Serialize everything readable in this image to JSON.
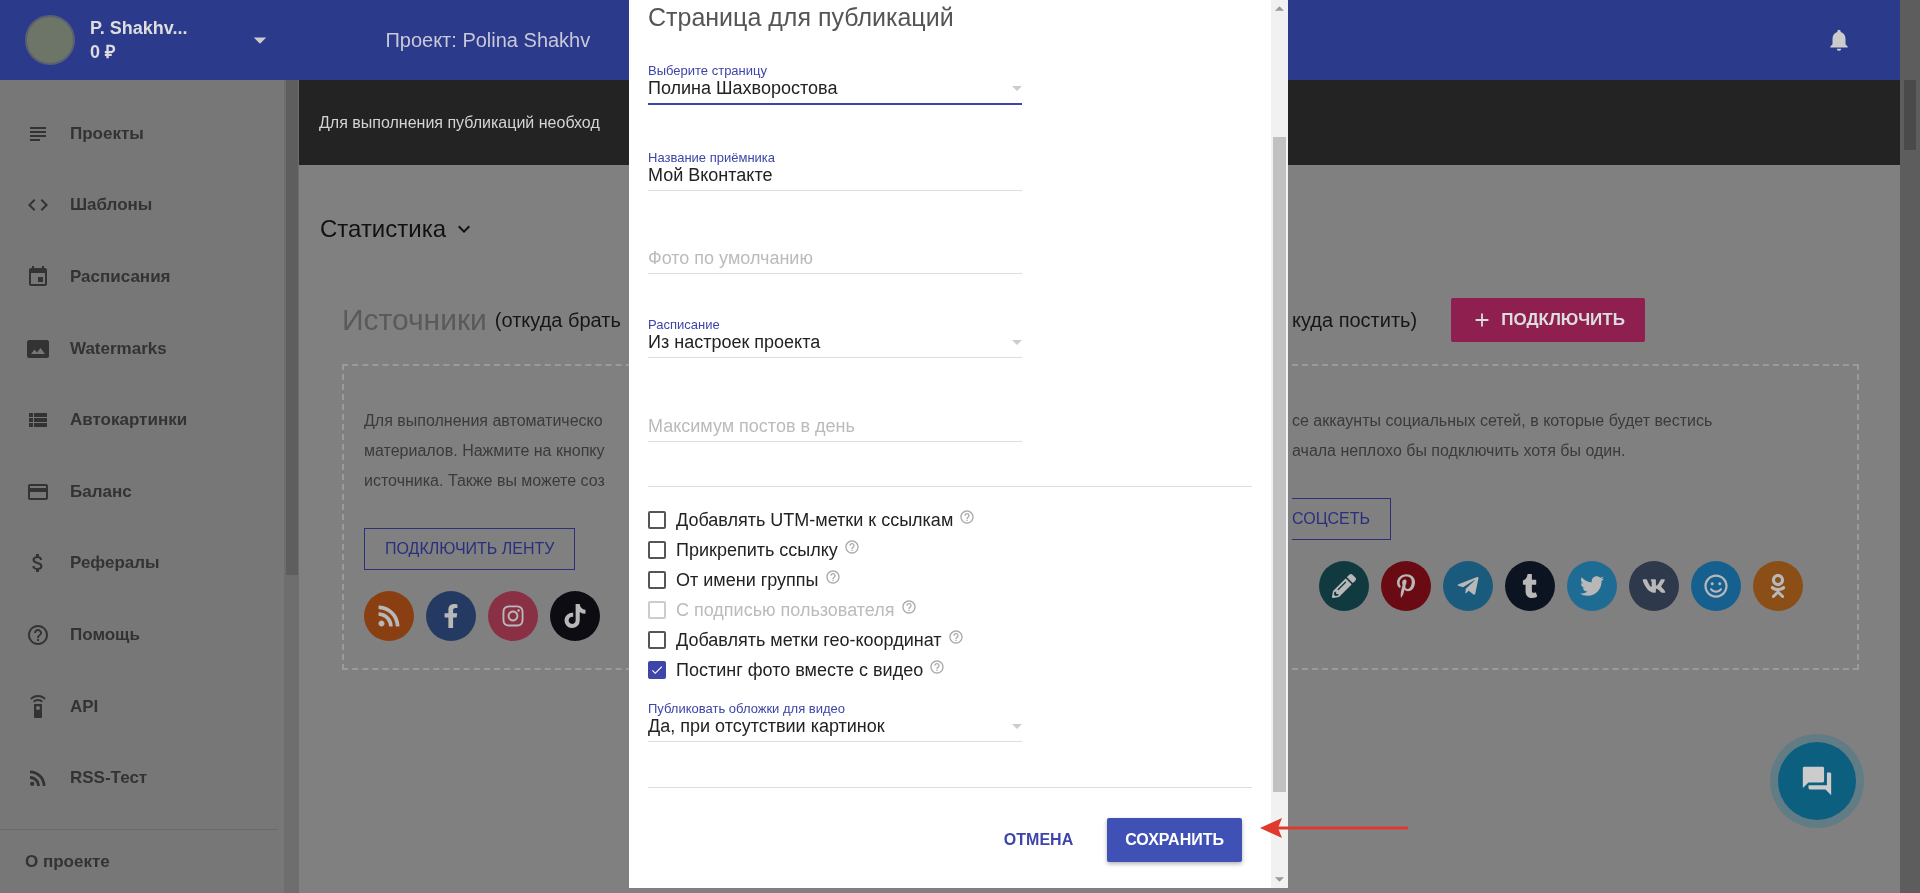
{
  "header": {
    "user_name": "P. Shakhv...",
    "balance": "0 ₽",
    "project_title": "Проект: Polina Shakhv"
  },
  "sidebar": {
    "items": [
      {
        "label": "Проекты"
      },
      {
        "label": "Шаблоны"
      },
      {
        "label": "Расписания"
      },
      {
        "label": "Watermarks"
      },
      {
        "label": "Автокартинки"
      },
      {
        "label": "Баланс"
      },
      {
        "label": "Рефералы"
      },
      {
        "label": "Помощь"
      },
      {
        "label": "API"
      },
      {
        "label": "RSS-Тест"
      }
    ],
    "footer": "О проекте"
  },
  "banner": "Для выполнения публикаций необход",
  "stats_label": "Статистика",
  "sources": {
    "title": "Источники",
    "subtitle": "(откуда брать",
    "text_lines": [
      "Для выполнения автоматическо",
      "материалов. Нажмите на кнопку",
      "источника. Также вы можете соз"
    ],
    "button": "ПОДКЛЮЧИТЬ ЛЕНТУ"
  },
  "targets": {
    "subtitle": "куда постить)",
    "connect_button": "ПОДКЛЮЧИТЬ",
    "text_lines": [
      "се аккаунты социальных сетей, в которые будет вестись",
      "ачала неплохо бы подключить хотя бы один."
    ],
    "button": "СОЦСЕТЬ"
  },
  "modal": {
    "title": "Страница для публикаций",
    "fields": [
      {
        "kind": "select",
        "label": "Выберите страницу",
        "value": "Полина Шахворостова",
        "focused": true
      },
      {
        "kind": "text",
        "label": "Название приёмника",
        "value": "Мой Вконтакте",
        "focused": false
      },
      {
        "kind": "text",
        "placeholder": "Фото по умолчанию",
        "focused": false
      },
      {
        "kind": "select",
        "label": "Расписание",
        "value": "Из настроек проекта",
        "focused": false
      },
      {
        "kind": "text",
        "placeholder": "Максимум постов в день",
        "focused": false
      }
    ],
    "checkboxes": [
      {
        "label": "Добавлять UTM-метки к ссылкам",
        "checked": false,
        "disabled": false
      },
      {
        "label": "Прикрепить ссылку",
        "checked": false,
        "disabled": false
      },
      {
        "label": "От имени группы",
        "checked": false,
        "disabled": false
      },
      {
        "label": "С подписью пользователя",
        "checked": false,
        "disabled": true
      },
      {
        "label": "Добавлять метки гео-координат",
        "checked": false,
        "disabled": false
      },
      {
        "label": "Постинг фото вместе с видео",
        "checked": true,
        "disabled": false
      }
    ],
    "cover_field": {
      "kind": "select",
      "label": "Публиковать обложки для видео",
      "value": "Да, при отсутствии картинок",
      "focused": false
    },
    "cancel_button": "ОТМЕНА",
    "save_button": "СОХРАНИТЬ"
  }
}
